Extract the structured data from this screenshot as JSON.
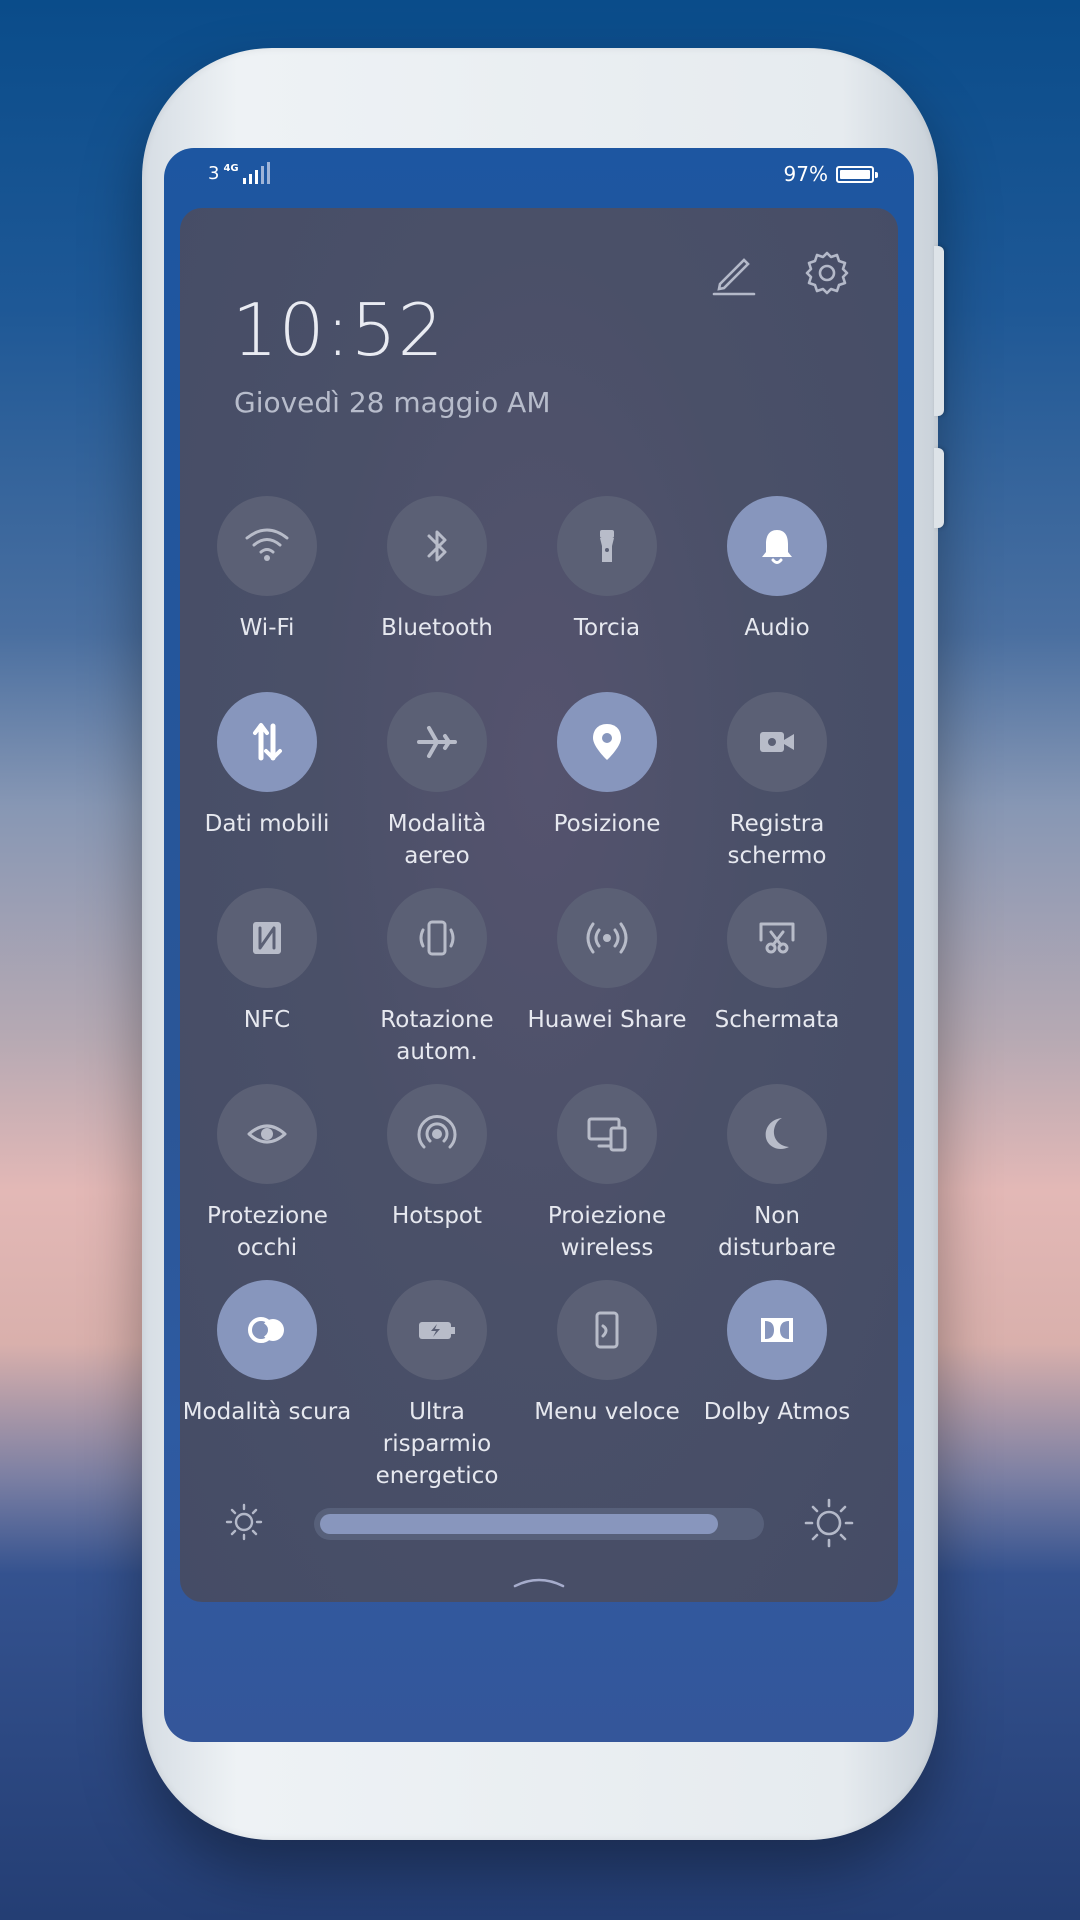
{
  "status_bar": {
    "carrier_signal": "3",
    "network": "4G",
    "battery_percent": "97%",
    "battery_level": 0.97
  },
  "header": {
    "time": "10:52",
    "date": "Giovedì 28 maggio  AM"
  },
  "tiles": [
    {
      "label": "Wi-Fi",
      "icon": "wifi-icon",
      "on": false
    },
    {
      "label": "Bluetooth",
      "icon": "bluetooth-icon",
      "on": false
    },
    {
      "label": "Torcia",
      "icon": "flashlight-icon",
      "on": false
    },
    {
      "label": "Audio",
      "icon": "bell-icon",
      "on": true
    },
    {
      "label": "Dati mobili",
      "icon": "mobile-data-icon",
      "on": true
    },
    {
      "label": "Modalità aereo",
      "icon": "airplane-icon",
      "on": false
    },
    {
      "label": "Posizione",
      "icon": "location-icon",
      "on": true
    },
    {
      "label": "Registra schermo",
      "icon": "screen-record-icon",
      "on": false
    },
    {
      "label": "NFC",
      "icon": "nfc-icon",
      "on": false
    },
    {
      "label": "Rotazione autom.",
      "icon": "auto-rotate-icon",
      "on": false
    },
    {
      "label": "Huawei Share",
      "icon": "huawei-share-icon",
      "on": false
    },
    {
      "label": "Schermata",
      "icon": "screenshot-icon",
      "on": false
    },
    {
      "label": "Protezione occhi",
      "icon": "eye-icon",
      "on": false
    },
    {
      "label": "Hotspot",
      "icon": "hotspot-icon",
      "on": false
    },
    {
      "label": "Proiezione wireless",
      "icon": "wireless-projection-icon",
      "on": false
    },
    {
      "label": "Non disturbare",
      "icon": "moon-icon",
      "on": false
    },
    {
      "label": "Modalità scura",
      "icon": "dark-mode-icon",
      "on": true
    },
    {
      "label": "Ultra risparmio energetico",
      "icon": "battery-saver-icon",
      "on": false
    },
    {
      "label": "Menu veloce",
      "icon": "quick-menu-icon",
      "on": false
    },
    {
      "label": "Dolby Atmos",
      "icon": "dolby-icon",
      "on": true
    }
  ],
  "brightness": {
    "level": 0.9
  },
  "colors": {
    "tile_on": "#8796bd",
    "tile_off": "#5b6075",
    "panel": "#484e67",
    "screen": "#1d56a1"
  }
}
